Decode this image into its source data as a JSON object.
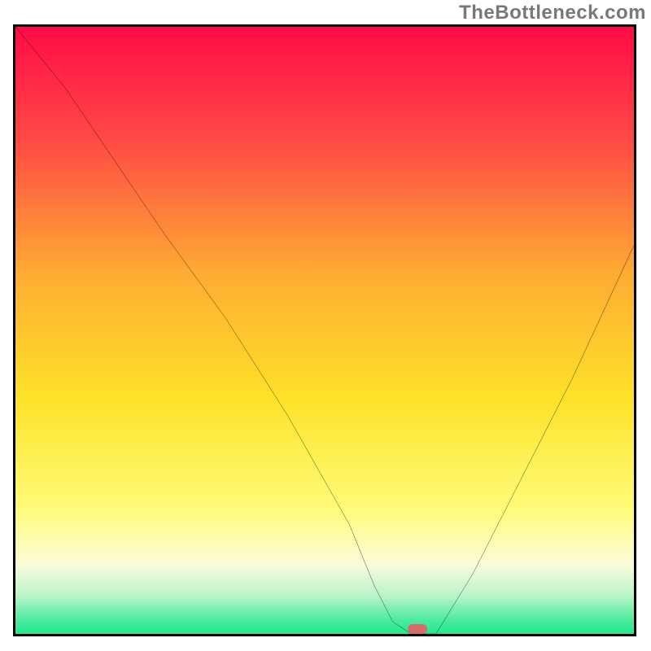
{
  "watermark": {
    "text": "TheBottleneck.com"
  },
  "chart_data": {
    "type": "line",
    "title": "",
    "xlabel": "",
    "ylabel": "",
    "xlim": [
      0,
      100
    ],
    "ylim": [
      0,
      100
    ],
    "grid": false,
    "legend": false,
    "background_gradient": {
      "stops": [
        {
          "pos": 0.0,
          "color": "#ff0b46"
        },
        {
          "pos": 0.18,
          "color": "#ff4845"
        },
        {
          "pos": 0.4,
          "color": "#feac33"
        },
        {
          "pos": 0.6,
          "color": "#fde228"
        },
        {
          "pos": 0.78,
          "color": "#fffc7a"
        },
        {
          "pos": 0.87,
          "color": "#fbfbdb"
        },
        {
          "pos": 0.92,
          "color": "#b9f4c8"
        },
        {
          "pos": 0.96,
          "color": "#4aeb9e"
        },
        {
          "pos": 1.0,
          "color": "#01e47f"
        }
      ]
    },
    "series": [
      {
        "name": "bottleneck-curve",
        "x": [
          0,
          8,
          16,
          24,
          34,
          44,
          54,
          58,
          61,
          64,
          68,
          74,
          82,
          90,
          100
        ],
        "values": [
          100,
          90,
          78,
          66,
          52,
          36,
          18,
          8,
          2,
          0,
          0,
          10,
          26,
          42,
          64
        ]
      }
    ],
    "marker": {
      "x": 65,
      "y": 0,
      "color": "#d66b6b"
    }
  }
}
